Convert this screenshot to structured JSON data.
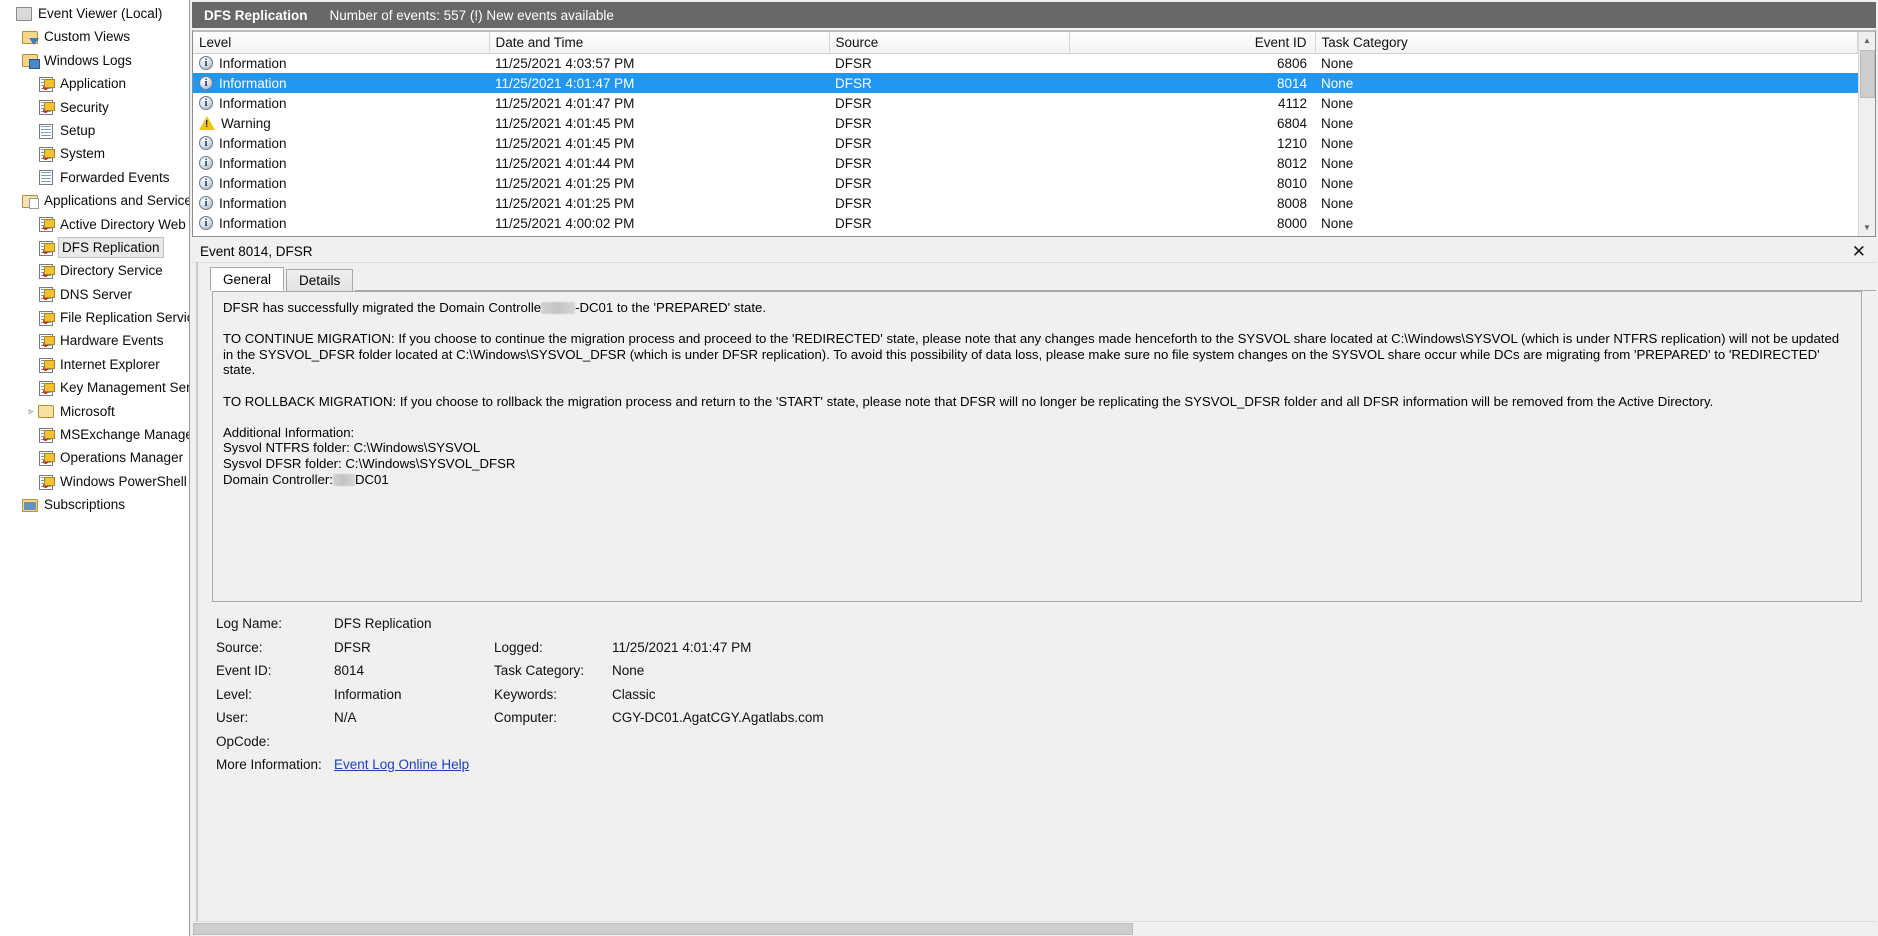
{
  "sidebar": {
    "items": [
      {
        "label": "Event Viewer (Local)",
        "icon": "console-root-icon",
        "indent": 0,
        "twisty": "",
        "selected": false,
        "kind": "root"
      },
      {
        "label": "Custom Views",
        "icon": "custom-views-folder-icon",
        "indent": 1,
        "twisty": "",
        "selected": false,
        "kind": "folder-filter"
      },
      {
        "label": "Windows Logs",
        "icon": "windows-logs-folder-icon",
        "indent": 1,
        "twisty": "",
        "selected": false,
        "kind": "folder-win"
      },
      {
        "label": "Application",
        "icon": "event-log-icon",
        "indent": 2,
        "twisty": "",
        "selected": false,
        "kind": "log-warn"
      },
      {
        "label": "Security",
        "icon": "event-log-icon",
        "indent": 2,
        "twisty": "",
        "selected": false,
        "kind": "log-warn"
      },
      {
        "label": "Setup",
        "icon": "event-log-icon",
        "indent": 2,
        "twisty": "",
        "selected": false,
        "kind": "log-plain"
      },
      {
        "label": "System",
        "icon": "event-log-icon",
        "indent": 2,
        "twisty": "",
        "selected": false,
        "kind": "log-warn"
      },
      {
        "label": "Forwarded Events",
        "icon": "event-log-icon",
        "indent": 2,
        "twisty": "",
        "selected": false,
        "kind": "log-plain"
      },
      {
        "label": "Applications and Services Lo",
        "icon": "applications-services-folder-icon",
        "indent": 1,
        "twisty": "",
        "selected": false,
        "kind": "folder-app"
      },
      {
        "label": "Active Directory Web Ser",
        "icon": "event-log-icon",
        "indent": 2,
        "twisty": "",
        "selected": false,
        "kind": "log-warn"
      },
      {
        "label": "DFS Replication",
        "icon": "event-log-icon",
        "indent": 2,
        "twisty": "",
        "selected": true,
        "kind": "log-warn"
      },
      {
        "label": "Directory Service",
        "icon": "event-log-icon",
        "indent": 2,
        "twisty": "",
        "selected": false,
        "kind": "log-warn"
      },
      {
        "label": "DNS Server",
        "icon": "event-log-icon",
        "indent": 2,
        "twisty": "",
        "selected": false,
        "kind": "log-warn"
      },
      {
        "label": "File Replication Service",
        "icon": "event-log-icon",
        "indent": 2,
        "twisty": "",
        "selected": false,
        "kind": "log-warn"
      },
      {
        "label": "Hardware Events",
        "icon": "event-log-icon",
        "indent": 2,
        "twisty": "",
        "selected": false,
        "kind": "log-warn"
      },
      {
        "label": "Internet Explorer",
        "icon": "event-log-icon",
        "indent": 2,
        "twisty": "",
        "selected": false,
        "kind": "log-warn"
      },
      {
        "label": "Key Management Service",
        "icon": "event-log-icon",
        "indent": 2,
        "twisty": "",
        "selected": false,
        "kind": "log-warn"
      },
      {
        "label": "Microsoft",
        "icon": "folder-icon",
        "indent": 2,
        "twisty": "▹",
        "selected": false,
        "kind": "folder-plain"
      },
      {
        "label": "MSExchange Manageme",
        "icon": "event-log-icon",
        "indent": 2,
        "twisty": "",
        "selected": false,
        "kind": "log-warn"
      },
      {
        "label": "Operations Manager",
        "icon": "event-log-icon",
        "indent": 2,
        "twisty": "",
        "selected": false,
        "kind": "log-warn"
      },
      {
        "label": "Windows PowerShell",
        "icon": "event-log-icon",
        "indent": 2,
        "twisty": "",
        "selected": false,
        "kind": "log-warn"
      },
      {
        "label": "Subscriptions",
        "icon": "subscriptions-icon",
        "indent": 1,
        "twisty": "",
        "selected": false,
        "kind": "subs"
      }
    ]
  },
  "log_header": {
    "title": "DFS Replication",
    "count_text": "Number of events: 557 (!) New events available"
  },
  "event_table": {
    "columns": [
      "Level",
      "Date and Time",
      "Source",
      "Event ID",
      "Task Category"
    ],
    "rows": [
      {
        "level": "Information",
        "level_icon": "information-icon",
        "datetime": "11/25/2021 4:03:57 PM",
        "source": "DFSR",
        "event_id": "6806",
        "task_category": "None",
        "selected": false
      },
      {
        "level": "Information",
        "level_icon": "information-icon",
        "datetime": "11/25/2021 4:01:47 PM",
        "source": "DFSR",
        "event_id": "8014",
        "task_category": "None",
        "selected": true
      },
      {
        "level": "Information",
        "level_icon": "information-icon",
        "datetime": "11/25/2021 4:01:47 PM",
        "source": "DFSR",
        "event_id": "4112",
        "task_category": "None",
        "selected": false
      },
      {
        "level": "Warning",
        "level_icon": "warning-icon",
        "datetime": "11/25/2021 4:01:45 PM",
        "source": "DFSR",
        "event_id": "6804",
        "task_category": "None",
        "selected": false
      },
      {
        "level": "Information",
        "level_icon": "information-icon",
        "datetime": "11/25/2021 4:01:45 PM",
        "source": "DFSR",
        "event_id": "1210",
        "task_category": "None",
        "selected": false
      },
      {
        "level": "Information",
        "level_icon": "information-icon",
        "datetime": "11/25/2021 4:01:44 PM",
        "source": "DFSR",
        "event_id": "8012",
        "task_category": "None",
        "selected": false
      },
      {
        "level": "Information",
        "level_icon": "information-icon",
        "datetime": "11/25/2021 4:01:25 PM",
        "source": "DFSR",
        "event_id": "8010",
        "task_category": "None",
        "selected": false
      },
      {
        "level": "Information",
        "level_icon": "information-icon",
        "datetime": "11/25/2021 4:01:25 PM",
        "source": "DFSR",
        "event_id": "8008",
        "task_category": "None",
        "selected": false
      },
      {
        "level": "Information",
        "level_icon": "information-icon",
        "datetime": "11/25/2021 4:00:02 PM",
        "source": "DFSR",
        "event_id": "8000",
        "task_category": "None",
        "selected": false
      }
    ]
  },
  "detail": {
    "title": "Event 8014, DFSR",
    "close_label": "✕",
    "tabs": [
      {
        "label": "General",
        "active": true
      },
      {
        "label": "Details",
        "active": false
      }
    ],
    "description": {
      "line1_a": "DFSR has successfully migrated the Domain Controlle",
      "line1_b": "-DC01 to the 'PREPARED' state.",
      "para2": "TO CONTINUE MIGRATION: If you choose to continue the migration process and proceed to the 'REDIRECTED' state, please note that any changes made henceforth to the SYSVOL share located at C:\\Windows\\SYSVOL (which is under NTFRS replication) will not be updated in the SYSVOL_DFSR folder located at C:\\Windows\\SYSVOL_DFSR (which is under DFSR replication). To avoid this possibility of data loss, please make sure no file system changes on the SYSVOL share occur while DCs are migrating from 'PREPARED' to 'REDIRECTED' state.",
      "para3": "TO ROLLBACK MIGRATION: If you choose to rollback the migration process and return to the 'START' state, please note that DFSR will no longer be replicating the SYSVOL_DFSR folder and all DFSR information will be removed from the Active Directory.",
      "addl_heading": "Additional Information:",
      "addl_line1": "Sysvol NTFRS folder: C:\\Windows\\SYSVOL",
      "addl_line2": "Sysvol DFSR folder: C:\\Windows\\SYSVOL_DFSR",
      "addl_line3_a": "Domain Controller:",
      "addl_line3_b": "DC01"
    },
    "meta": {
      "log_name_label": "Log Name:",
      "log_name_value": "DFS Replication",
      "source_label": "Source:",
      "source_value": "DFSR",
      "logged_label": "Logged:",
      "logged_value": "11/25/2021 4:01:47 PM",
      "event_id_label": "Event ID:",
      "event_id_value": "8014",
      "task_category_label": "Task Category:",
      "task_category_value": "None",
      "level_label": "Level:",
      "level_value": "Information",
      "keywords_label": "Keywords:",
      "keywords_value": "Classic",
      "user_label": "User:",
      "user_value": "N/A",
      "computer_label": "Computer:",
      "computer_value": "CGY-DC01.AgatCGY.Agatlabs.com",
      "opcode_label": "OpCode:",
      "opcode_value": "",
      "more_info_label": "More Information:",
      "more_info_link": "Event Log Online Help"
    }
  },
  "colors": {
    "selection_blue": "#2196f3",
    "header_gray": "#686868",
    "link_blue": "#1a40c0",
    "warning_yellow": "#f0c419"
  }
}
